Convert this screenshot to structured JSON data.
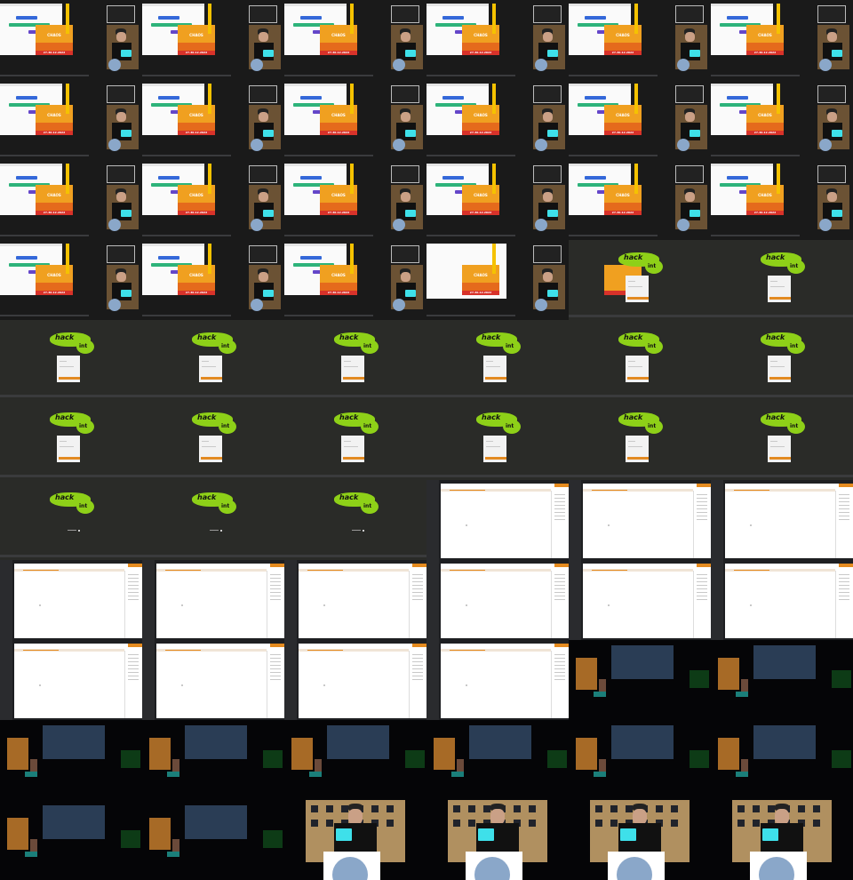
{
  "grid": {
    "columns": 6,
    "rows": 11,
    "tiles": [
      "slide",
      "slide",
      "slide",
      "slide",
      "slide",
      "slide",
      "slide",
      "slide",
      "slide",
      "slide",
      "slide",
      "slide",
      "slide",
      "slide",
      "slide",
      "slide",
      "slide",
      "slide",
      "slide",
      "slide",
      "slide",
      "blank-slide",
      "hack-title",
      "hack-login",
      "hack-login",
      "hack-login",
      "hack-login",
      "hack-login",
      "hack-login",
      "hack-login",
      "hack-login",
      "hack-login",
      "hack-login",
      "hack-login",
      "hack-login",
      "hack-login",
      "hack-loading",
      "hack-loading",
      "hack-loading",
      "notes",
      "notes",
      "notes",
      "notes",
      "notes",
      "notes",
      "notes",
      "notes",
      "notes",
      "notes",
      "notes",
      "notes",
      "notes",
      "stage",
      "stage",
      "stage",
      "stage",
      "stage",
      "stage",
      "stage",
      "stage",
      "stage",
      "stage",
      "speaker",
      "speaker",
      "speaker",
      "speaker"
    ]
  },
  "slide": {
    "poster_word": "CHAOS",
    "poster_date": "27-30.12.2022",
    "colors": {
      "poster": "#f0a020",
      "date_band": "#d8322a",
      "button_blue": "#3468d9",
      "button_green": "#2db37a",
      "button_purple": "#6446c9"
    }
  },
  "hack": {
    "logo_word": "hack",
    "logo_suffix": "int",
    "colors": {
      "logo_green": "#8ed018",
      "panel_button": "#e28a22",
      "background": "#2a2b28"
    }
  },
  "notes": {
    "colors": {
      "accent": "#e58b1f",
      "page": "#ffffff"
    }
  },
  "stage": {
    "colors": {
      "screen": "#2a3d55",
      "led_wall": "#0d3b16",
      "laptop_glow": "#3ee0ea"
    }
  }
}
